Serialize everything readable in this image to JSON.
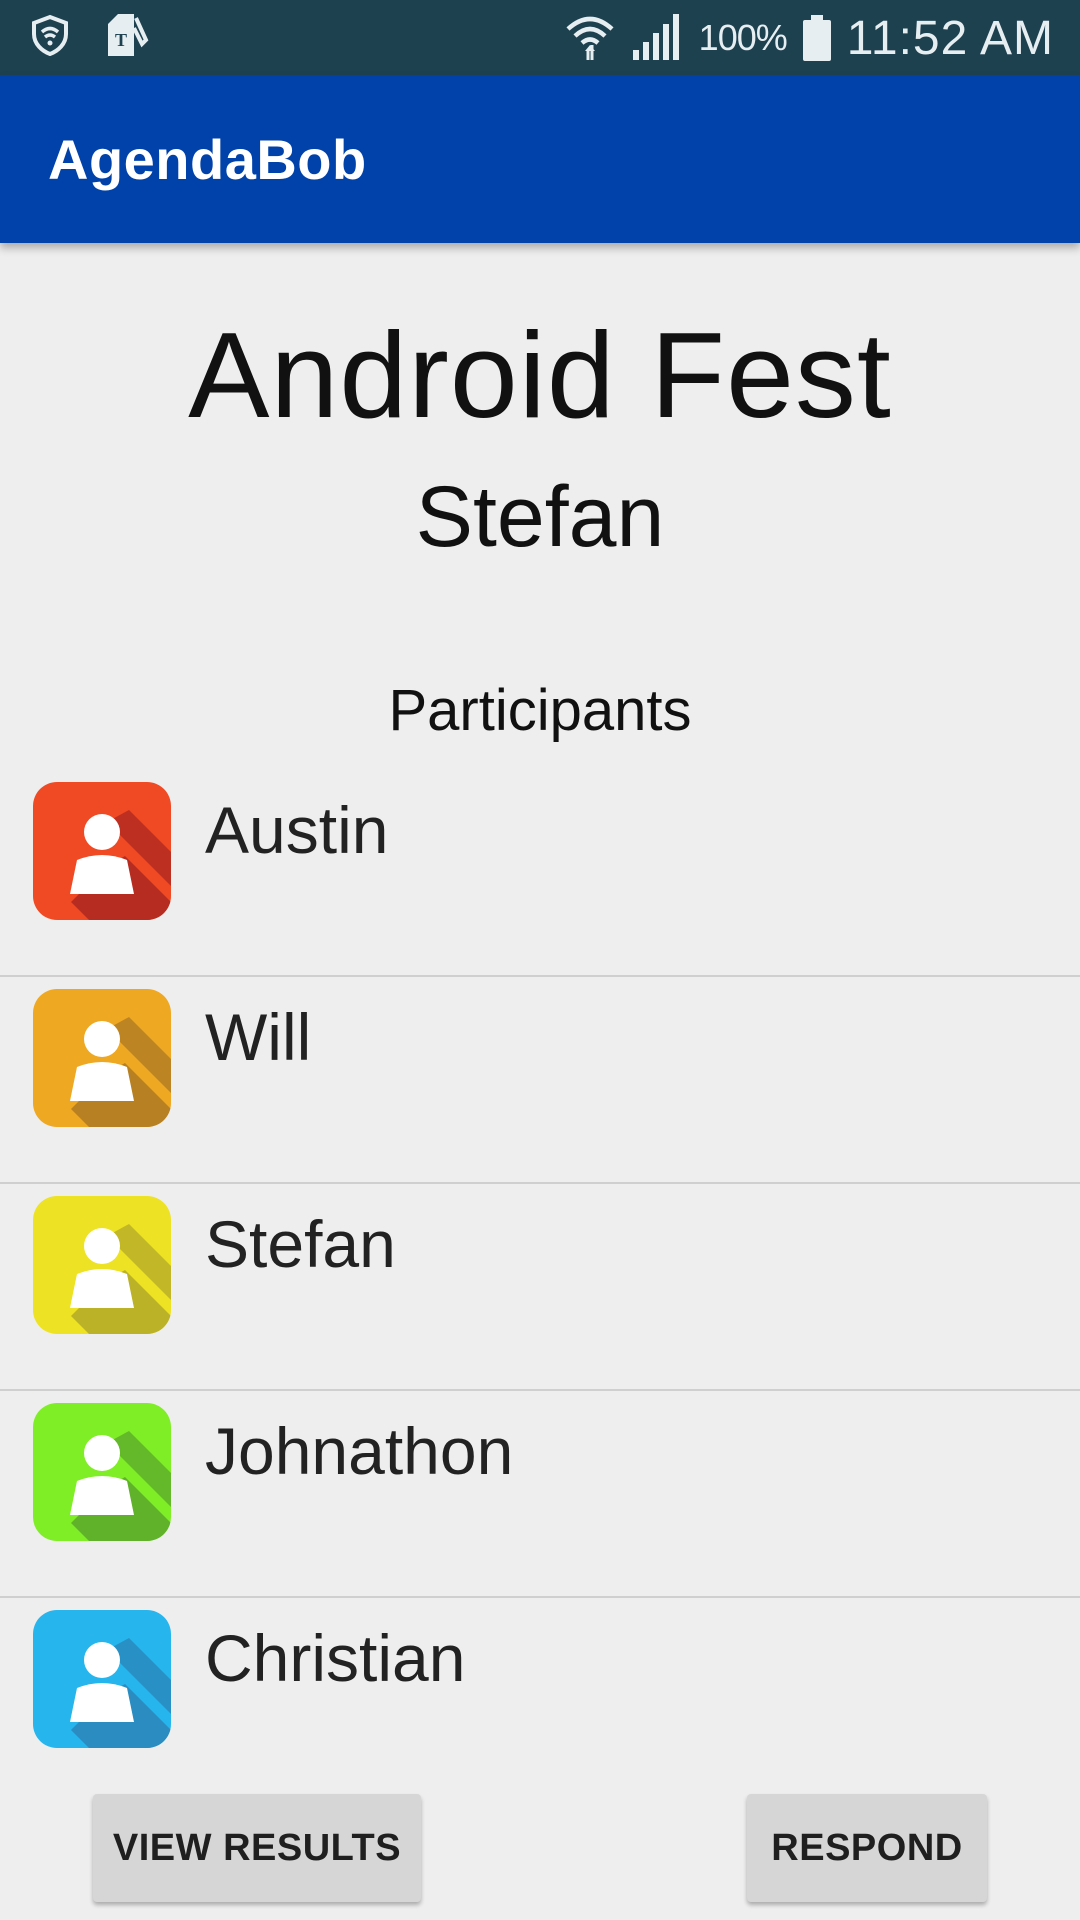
{
  "status_bar": {
    "battery_text": "100%",
    "time": "11:52 AM",
    "icons": [
      "shield-icon",
      "sim-tool-icon",
      "wifi-icon",
      "signal-icon",
      "battery-icon"
    ]
  },
  "app_bar": {
    "title": "AgendaBob"
  },
  "event": {
    "title": "Android Fest",
    "host": "Stefan"
  },
  "participants": {
    "heading": "Participants",
    "items": [
      {
        "name": "Austin",
        "color": "#f04a24",
        "shadow": "#b72c20"
      },
      {
        "name": "Will",
        "color": "#efa822",
        "shadow": "#b78023"
      },
      {
        "name": "Stefan",
        "color": "#eee224",
        "shadow": "#bcb227"
      },
      {
        "name": "Johnathon",
        "color": "#7fee26",
        "shadow": "#60b22a"
      },
      {
        "name": "Christian",
        "color": "#27b5ee",
        "shadow": "#2a8cc0"
      }
    ]
  },
  "actions": {
    "view_results": "VIEW RESULTS",
    "respond": "RESPOND"
  },
  "colors": {
    "status_bar": "#1e4150",
    "app_bar": "#0042aa",
    "background": "#eeeeee"
  }
}
